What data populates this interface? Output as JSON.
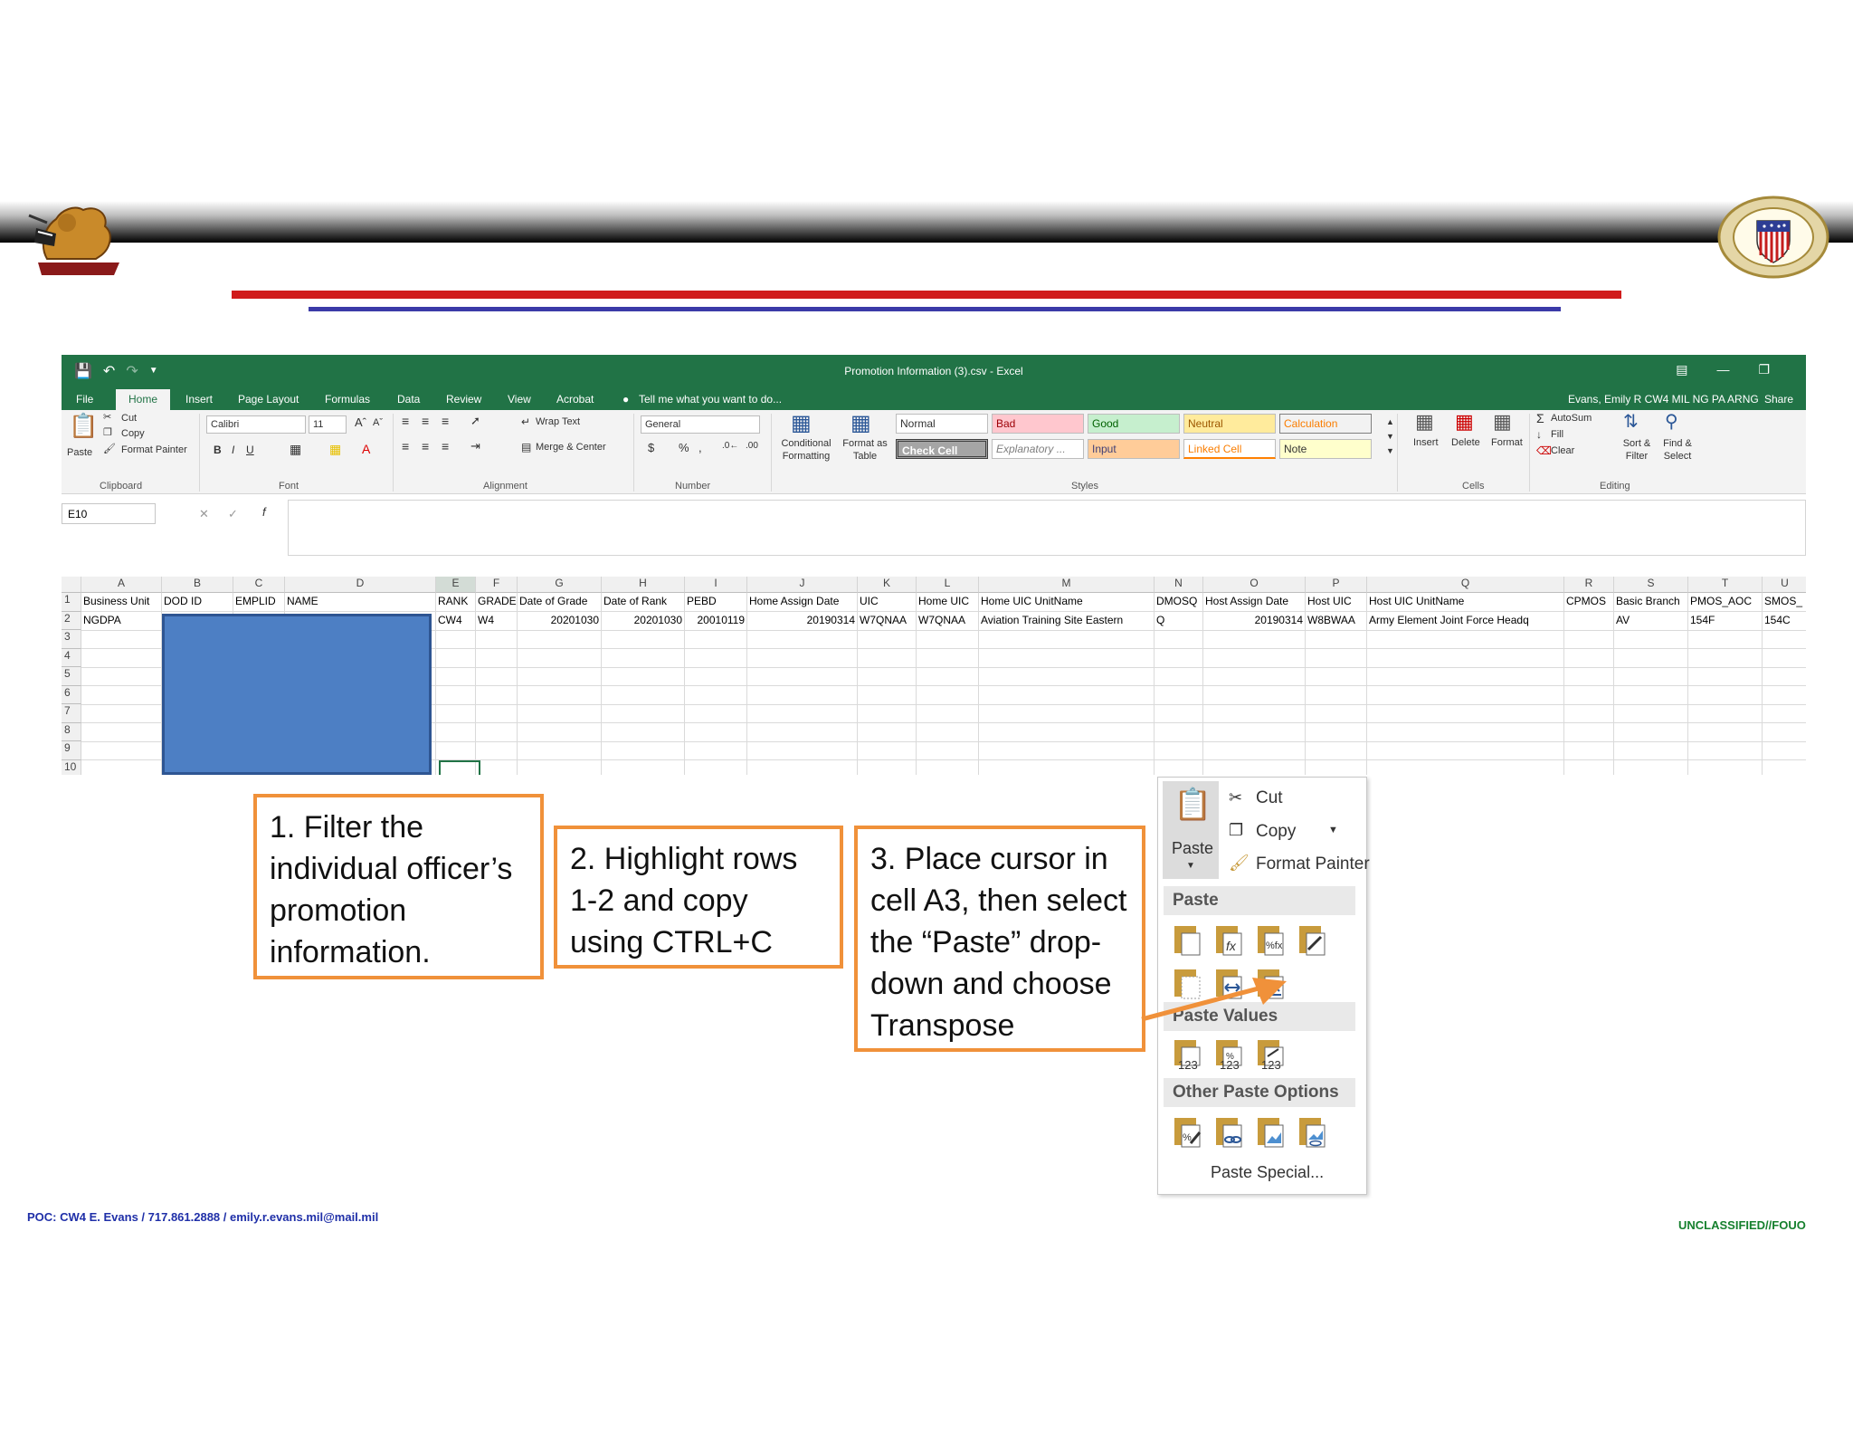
{
  "excel": {
    "window_title": "Promotion Information (3).csv - Excel",
    "menu_tabs": [
      "File",
      "Home",
      "Insert",
      "Page Layout",
      "Formulas",
      "Data",
      "Review",
      "View",
      "Acrobat"
    ],
    "tell_me": "Tell me what you want to do...",
    "user": "Evans, Emily R CW4 MIL NG PA ARNG",
    "share": "Share",
    "clipboard": {
      "paste": "Paste",
      "cut": "Cut",
      "copy": "Copy",
      "format_painter": "Format Painter",
      "label": "Clipboard"
    },
    "font": {
      "name": "Calibri",
      "size": "11",
      "label": "Font"
    },
    "alignment": {
      "wrap": "Wrap Text",
      "merge": "Merge & Center",
      "label": "Alignment"
    },
    "number": {
      "format": "General",
      "label": "Number"
    },
    "styles": {
      "conditional": "Conditional Formatting",
      "format_as_table": "Format as Table",
      "cells": [
        "Normal",
        "Bad",
        "Good",
        "Neutral",
        "Calculation",
        "Check Cell",
        "Explanatory ...",
        "Input",
        "Linked Cell",
        "Note"
      ],
      "label": "Styles"
    },
    "cells_group": {
      "insert": "Insert",
      "delete": "Delete",
      "format": "Format",
      "label": "Cells"
    },
    "editing": {
      "autosum": "AutoSum",
      "fill": "Fill",
      "clear": "Clear",
      "sort": "Sort & Filter",
      "find": "Find & Select",
      "label": "Editing"
    },
    "name_box": "E10",
    "columns": [
      "A",
      "B",
      "C",
      "D",
      "E",
      "F",
      "G",
      "H",
      "I",
      "J",
      "K",
      "L",
      "M",
      "N",
      "O",
      "P",
      "Q",
      "R",
      "S",
      "T",
      "U"
    ],
    "row_numbers": [
      "1",
      "2",
      "3",
      "4",
      "5",
      "6",
      "7",
      "8",
      "9",
      "10"
    ],
    "header_row": [
      "Business Unit",
      "DOD ID",
      "EMPLID",
      "NAME",
      "RANK",
      "GRADE",
      "Date of Grade",
      "Date of Rank",
      "PEBD",
      "Home Assign Date",
      "UIC",
      "Home UIC",
      "Home UIC UnitName",
      "DMOSQ",
      "Host Assign Date",
      "Host UIC",
      "Host UIC UnitName",
      "CPMOS",
      "Basic Branch",
      "PMOS_AOC",
      "SMOS_"
    ],
    "data_row": [
      "NGDPA",
      "",
      "",
      "",
      "CW4",
      "W4",
      "20201030",
      "20201030",
      "20010119",
      "20190314",
      "W7QNAA",
      "W7QNAA",
      "Aviation Training Site Eastern",
      "Q",
      "20190314",
      "W8BWAA",
      "Army Element Joint Force Headq",
      "",
      "AV",
      "154F",
      "154C"
    ]
  },
  "callouts": {
    "step1": "1. Filter the individual officer’s promotion information.",
    "step2": "2. Highlight rows 1-2 and copy using CTRL+C",
    "step3": "3. Place cursor in cell A3, then select the “Paste” drop-down and choose Transpose"
  },
  "paste_menu": {
    "paste_button": "Paste",
    "cut": "Cut",
    "copy": "Copy",
    "format_painter": "Format Painter",
    "section_paste": "Paste",
    "section_values": "Paste Values",
    "section_other": "Other Paste Options",
    "values_icons": [
      "123",
      "123",
      "123"
    ],
    "paste_special": "Paste Special..."
  },
  "footer": {
    "poc": "POC: CW4 E. Evans / 717.861.2888 / emily.r.evans.mil@mail.mil",
    "classification": "UNCLASSIFIED//FOUO"
  },
  "colors": {
    "excel_green": "#217346",
    "callout_border": "#f0913a",
    "redaction": "#4d7fc4",
    "header_red": "#d01b1b",
    "header_blue": "#3b3aa8"
  }
}
